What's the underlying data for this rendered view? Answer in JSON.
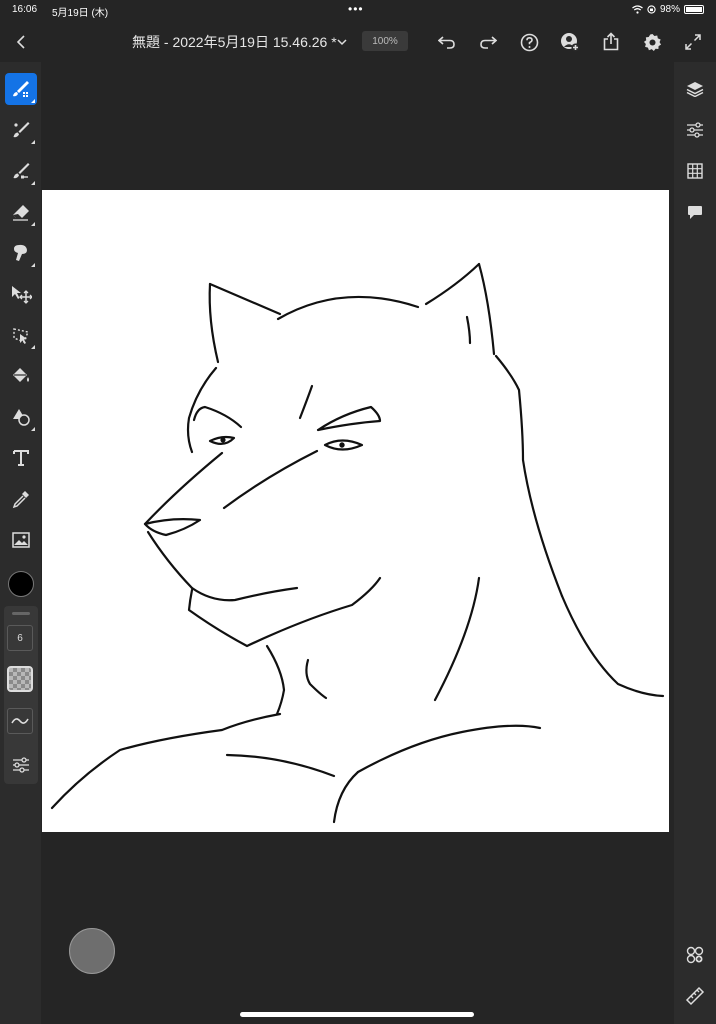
{
  "status_bar": {
    "time": "16:06",
    "date": "5月19日 (木)",
    "dots": "•••",
    "battery": "98%",
    "battery_level": 0.98
  },
  "toolbar": {
    "document_title": "無題 - 2022年5月19日 15.46.26 *",
    "zoom": "100%"
  },
  "tools": [
    {
      "name": "pixel-brush-tool-icon",
      "active": true
    },
    {
      "name": "live-brush-tool-icon"
    },
    {
      "name": "vector-brush-tool-icon"
    },
    {
      "name": "eraser-tool-icon"
    },
    {
      "name": "smudge-tool-icon"
    },
    {
      "name": "move-transform-tool-icon"
    },
    {
      "name": "selection-tool-icon"
    },
    {
      "name": "fill-tool-icon"
    },
    {
      "name": "shape-tool-icon"
    },
    {
      "name": "text-tool-icon"
    },
    {
      "name": "eyedropper-tool-icon"
    },
    {
      "name": "image-tool-icon"
    }
  ],
  "brush": {
    "color": "#000000",
    "size": "6"
  },
  "colors": {
    "accent": "#1473e6",
    "canvas": "#ffffff",
    "background": "#252525"
  }
}
